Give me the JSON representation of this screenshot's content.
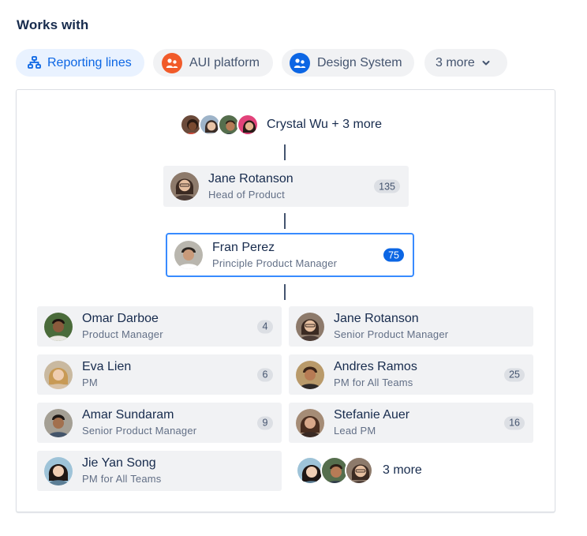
{
  "header": {
    "title": "Works with"
  },
  "chips": [
    {
      "label": "Reporting lines",
      "icon": "hierarchy-icon",
      "active": true
    },
    {
      "label": "AUI platform",
      "icon": "team-icon",
      "color": "#f15b2a"
    },
    {
      "label": "Design System",
      "icon": "team-icon",
      "color": "#0c66e4"
    },
    {
      "label": "3 more",
      "icon": "chevron-down-icon"
    }
  ],
  "managers": {
    "label": "Crystal Wu + 3 more"
  },
  "manager": {
    "name": "Jane Rotanson",
    "role": "Head of Product",
    "count": "135"
  },
  "current": {
    "name": "Fran Perez",
    "role": "Principle Product Manager",
    "count": "75"
  },
  "reports": [
    {
      "name": "Omar Darboe",
      "role": "Product Manager",
      "count": "4"
    },
    {
      "name": "Jane Rotanson",
      "role": "Senior Product Manager",
      "count": ""
    },
    {
      "name": "Eva Lien",
      "role": "PM",
      "count": "6"
    },
    {
      "name": "Andres Ramos",
      "role": "PM for All Teams",
      "count": "25"
    },
    {
      "name": "Amar Sundaram",
      "role": "Senior Product Manager",
      "count": "9"
    },
    {
      "name": "Stefanie Auer",
      "role": "Lead PM",
      "count": "16"
    },
    {
      "name": "Jie Yan Song",
      "role": "PM for All Teams",
      "count": ""
    }
  ],
  "more_reports": {
    "label": "3 more"
  },
  "colors": {
    "accent": "#0c66e4",
    "focus_border": "#388bff",
    "card_bg": "#f1f2f4",
    "text": "#172b4d",
    "subtle_text": "#626f86"
  }
}
